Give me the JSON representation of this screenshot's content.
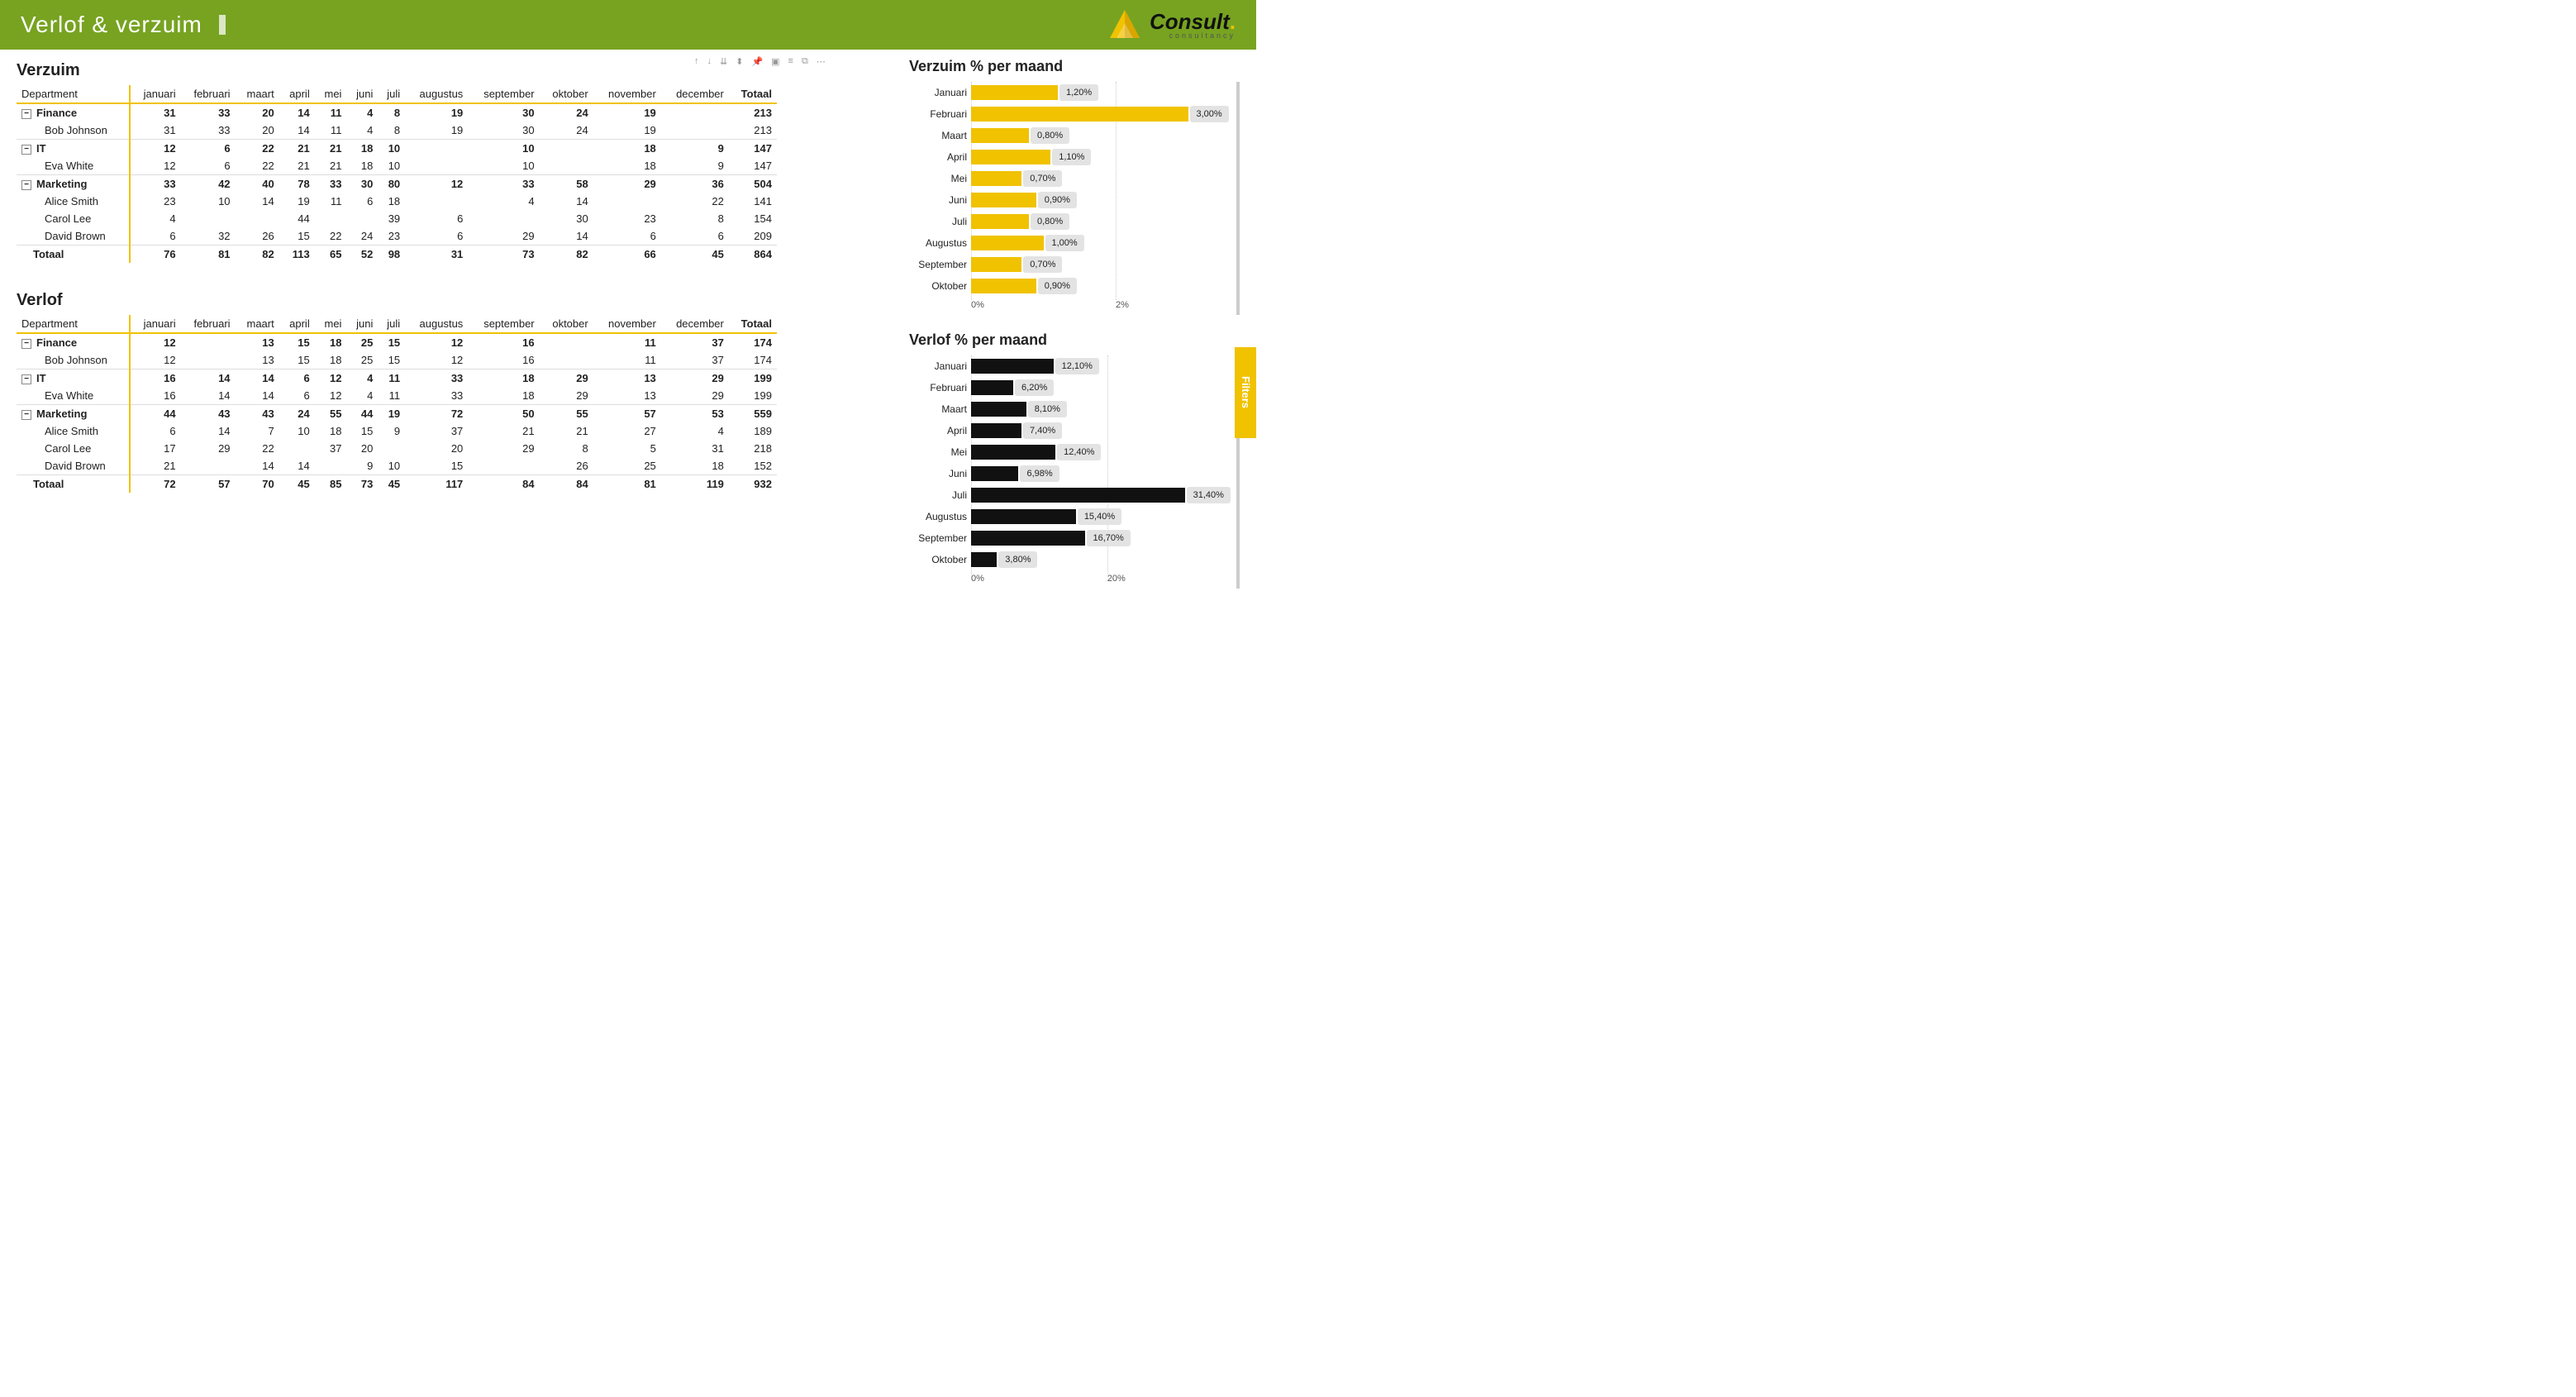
{
  "header": {
    "title": "Verlof & verzuim",
    "brand_main": "Consult",
    "brand_sub": "consultancy",
    "brand_dot_color": "#f0c200"
  },
  "filters_tab": "Filters",
  "toolbar_icons": [
    "arrow-up",
    "arrow-down",
    "drill",
    "hierarchy",
    "pin",
    "focus",
    "filter",
    "copy",
    "more"
  ],
  "months": [
    "januari",
    "februari",
    "maart",
    "april",
    "mei",
    "juni",
    "juli",
    "augustus",
    "september",
    "oktober",
    "november",
    "december"
  ],
  "row_header": "Department",
  "total_label": "Totaal",
  "verzuim": {
    "title": "Verzuim",
    "groups": [
      {
        "name": "Finance",
        "values": [
          31,
          33,
          20,
          14,
          11,
          4,
          8,
          19,
          30,
          24,
          19,
          null
        ],
        "total": 213,
        "rows": [
          {
            "name": "Bob Johnson",
            "values": [
              31,
              33,
              20,
              14,
              11,
              4,
              8,
              19,
              30,
              24,
              19,
              null
            ],
            "total": 213
          }
        ]
      },
      {
        "name": "IT",
        "values": [
          12,
          6,
          22,
          21,
          21,
          18,
          10,
          null,
          10,
          null,
          18,
          9
        ],
        "total": 147,
        "rows": [
          {
            "name": "Eva White",
            "values": [
              12,
              6,
              22,
              21,
              21,
              18,
              10,
              null,
              10,
              null,
              18,
              9
            ],
            "total": 147
          }
        ]
      },
      {
        "name": "Marketing",
        "values": [
          33,
          42,
          40,
          78,
          33,
          30,
          80,
          12,
          33,
          58,
          29,
          36
        ],
        "total": 504,
        "rows": [
          {
            "name": "Alice Smith",
            "values": [
              23,
              10,
              14,
              19,
              11,
              6,
              18,
              null,
              4,
              14,
              null,
              22
            ],
            "total": 141
          },
          {
            "name": "Carol Lee",
            "values": [
              4,
              null,
              null,
              44,
              null,
              null,
              39,
              6,
              null,
              30,
              23,
              8
            ],
            "total": 154
          },
          {
            "name": "David Brown",
            "values": [
              6,
              32,
              26,
              15,
              22,
              24,
              23,
              6,
              29,
              14,
              6,
              6
            ],
            "total": 209
          }
        ]
      }
    ],
    "grand": {
      "values": [
        76,
        81,
        82,
        113,
        65,
        52,
        98,
        31,
        73,
        82,
        66,
        45
      ],
      "total": 864
    }
  },
  "verlof": {
    "title": "Verlof",
    "groups": [
      {
        "name": "Finance",
        "values": [
          12,
          null,
          13,
          15,
          18,
          25,
          15,
          12,
          16,
          null,
          11,
          37
        ],
        "total": 174,
        "rows": [
          {
            "name": "Bob Johnson",
            "values": [
              12,
              null,
              13,
              15,
              18,
              25,
              15,
              12,
              16,
              null,
              11,
              37
            ],
            "total": 174
          }
        ]
      },
      {
        "name": "IT",
        "values": [
          16,
          14,
          14,
          6,
          12,
          4,
          11,
          33,
          18,
          29,
          13,
          29
        ],
        "total": 199,
        "rows": [
          {
            "name": "Eva White",
            "values": [
              16,
              14,
              14,
              6,
              12,
              4,
              11,
              33,
              18,
              29,
              13,
              29
            ],
            "total": 199
          }
        ]
      },
      {
        "name": "Marketing",
        "values": [
          44,
          43,
          43,
          24,
          55,
          44,
          19,
          72,
          50,
          55,
          57,
          53
        ],
        "total": 559,
        "rows": [
          {
            "name": "Alice Smith",
            "values": [
              6,
              14,
              7,
              10,
              18,
              15,
              9,
              37,
              21,
              21,
              27,
              4
            ],
            "total": 189
          },
          {
            "name": "Carol Lee",
            "values": [
              17,
              29,
              22,
              null,
              37,
              20,
              null,
              20,
              29,
              8,
              5,
              31
            ],
            "total": 218
          },
          {
            "name": "David Brown",
            "values": [
              21,
              null,
              14,
              14,
              null,
              9,
              10,
              15,
              null,
              26,
              25,
              18
            ],
            "total": 152
          }
        ]
      }
    ],
    "grand": {
      "values": [
        72,
        57,
        70,
        45,
        85,
        73,
        45,
        117,
        84,
        84,
        81,
        119
      ],
      "total": 932
    }
  },
  "chart_data": [
    {
      "type": "bar",
      "orientation": "horizontal",
      "title": "Verzuim % per maand",
      "categories": [
        "Januari",
        "Februari",
        "Maart",
        "April",
        "Mei",
        "Juni",
        "Juli",
        "Augustus",
        "September",
        "Oktober"
      ],
      "values": [
        1.2,
        3.0,
        0.8,
        1.1,
        0.7,
        0.9,
        0.8,
        1.0,
        0.7,
        0.9
      ],
      "value_labels": [
        "1,20%",
        "3,00%",
        "0,80%",
        "1,10%",
        "0,70%",
        "0,90%",
        "0,80%",
        "1,00%",
        "0,70%",
        "0,90%"
      ],
      "xlabel": "",
      "ylabel": "",
      "xlim": [
        0,
        3.2
      ],
      "ticks": [
        0,
        2
      ],
      "tick_labels": [
        "0%",
        "2%"
      ],
      "bar_color": "#f0c200"
    },
    {
      "type": "bar",
      "orientation": "horizontal",
      "title": "Verlof % per maand",
      "categories": [
        "Januari",
        "Februari",
        "Maart",
        "April",
        "Mei",
        "Juni",
        "Juli",
        "Augustus",
        "September",
        "Oktober"
      ],
      "values": [
        12.1,
        6.2,
        8.1,
        7.4,
        12.4,
        6.98,
        31.4,
        15.4,
        16.7,
        3.8
      ],
      "value_labels": [
        "12,10%",
        "6,20%",
        "8,10%",
        "7,40%",
        "12,40%",
        "6,98%",
        "31,40%",
        "15,40%",
        "16,70%",
        "3,80%"
      ],
      "xlabel": "",
      "ylabel": "",
      "xlim": [
        0,
        34
      ],
      "ticks": [
        0,
        20
      ],
      "tick_labels": [
        "0%",
        "20%"
      ],
      "bar_color": "#111111"
    }
  ]
}
